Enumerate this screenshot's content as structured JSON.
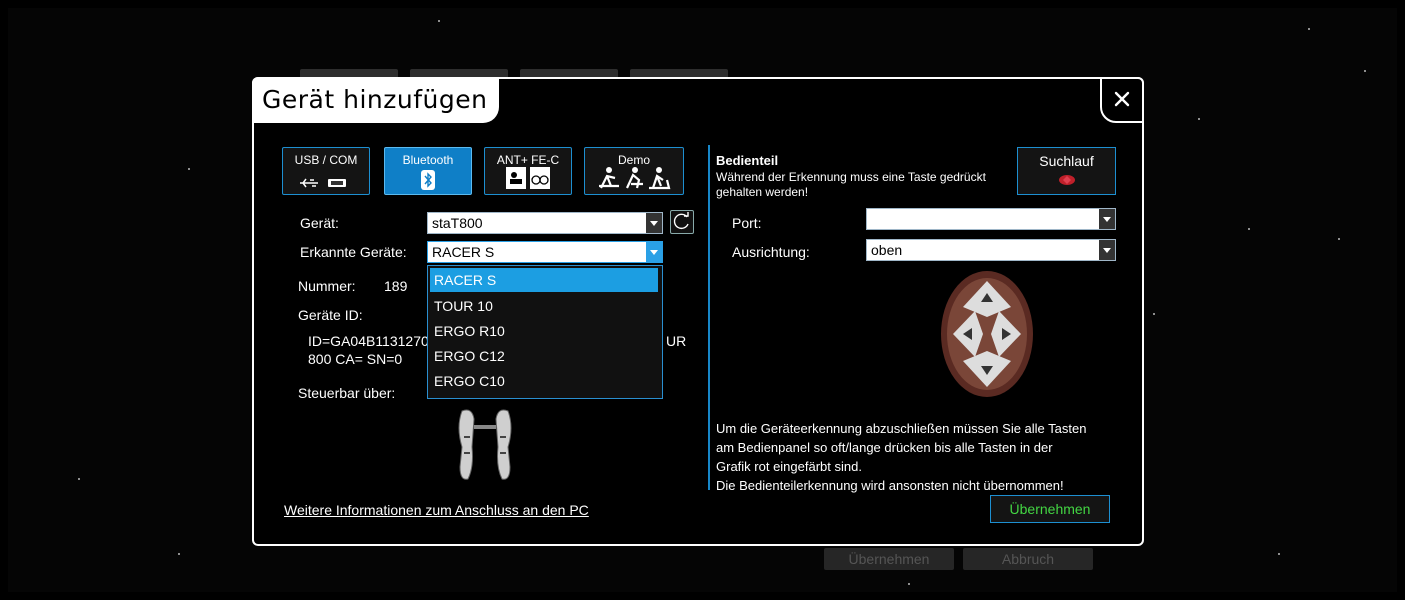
{
  "background": {
    "bottom_buttons": [
      "Übernehmen",
      "Abbruch"
    ]
  },
  "dialog": {
    "title": "Gerät hinzufügen",
    "close_label": "Close"
  },
  "tabs": [
    {
      "label": "USB / COM",
      "icon": "usb-serial-icon",
      "active": false
    },
    {
      "label": "Bluetooth",
      "icon": "bluetooth-icon",
      "active": true
    },
    {
      "label": "ANT+ FE-C",
      "icon": "ant-fec-icon",
      "active": false
    },
    {
      "label": "Demo",
      "icon": "demo-fitness-icon",
      "active": false
    }
  ],
  "left": {
    "device_label": "Gerät:",
    "device_value": "staT800",
    "detected_label": "Erkannte Geräte:",
    "detected_value": "RACER S",
    "dropdown_options": [
      "RACER S",
      "TOUR 10",
      "ERGO R10",
      "ERGO C12",
      "ERGO C10"
    ],
    "dropdown_selected": "RACER S",
    "number_label": "Nummer:",
    "number_value": "189",
    "device_id_label": "Geräte ID:",
    "device_id_line1": "ID=GA04B1131270",
    "device_id_line2": "800 CA= SN=0",
    "device_id_tail": "UR",
    "controllable_label": "Steuerbar über:",
    "more_info_link": "Weitere Informationen zum Anschluss an den PC"
  },
  "right": {
    "panel_title": "Bedienteil",
    "panel_desc": "Während der Erkennung muss eine Taste gedrückt gehalten werden!",
    "scan_label": "Suchlauf",
    "port_label": "Port:",
    "port_value": "",
    "orientation_label": "Ausrichtung:",
    "orientation_value": "oben",
    "instructions": [
      "Um die Geräteerkennung abzuschließen müssen Sie alle Tasten",
      "am Bedienpanel so oft/lange drücken bis alle Tasten in der",
      "Grafik rot eingefärbt sind.",
      "Die Bedienteilerkennung wird ansonsten nicht übernommen!"
    ],
    "apply_label": "Übernehmen"
  },
  "colors": {
    "accent": "#1d8fd1",
    "active_tab": "#0f7fc7",
    "apply_text": "#43d643",
    "selected_item": "#1c9ee2",
    "scan_indicator": "#c0202a"
  }
}
